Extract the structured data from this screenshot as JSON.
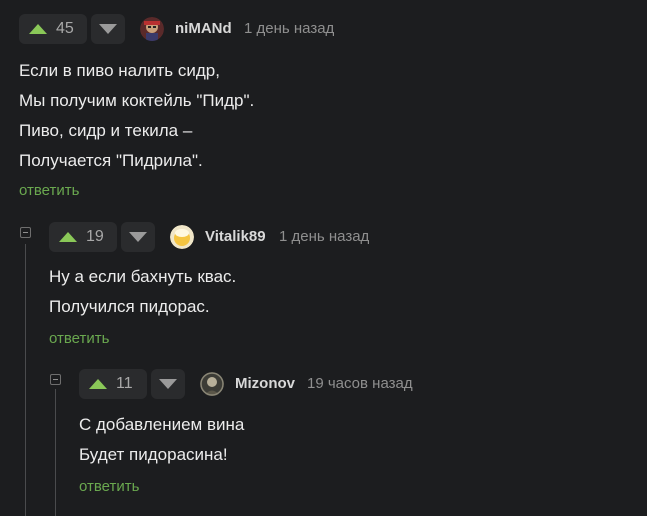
{
  "comments": [
    {
      "rating": "45",
      "username": "niMANd",
      "time": "1 день назад",
      "lines": [
        "Если в пиво налить сидр,",
        "Мы получим коктейль \"Пидр\".",
        "Пиво, сидр и текила –",
        "Получается \"Пидрила\"."
      ],
      "reply": "ответить"
    },
    {
      "rating": "19",
      "username": "Vitalik89",
      "time": "1 день назад",
      "lines": [
        "Ну а если бахнуть квас.",
        "Получился пидорас."
      ],
      "reply": "ответить"
    },
    {
      "rating": "11",
      "username": "Mizonov",
      "time": "19 часов назад",
      "lines": [
        "С добавлением вина",
        "Будет пидорасина!"
      ],
      "reply": "ответить"
    }
  ],
  "colors": {
    "background": "#1c1d1f",
    "upvote": "#8ac858",
    "reply_link": "#6aa84f",
    "text": "#ececec",
    "muted": "#8f8f8f"
  },
  "icons": {
    "upvote": "up-arrow-icon",
    "downvote": "down-arrow-icon",
    "collapse": "collapse-minus-icon"
  }
}
